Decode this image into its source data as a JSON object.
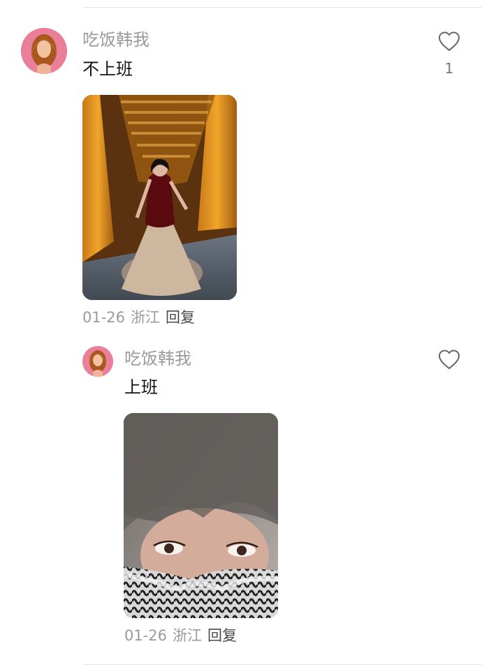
{
  "comment": {
    "username": "吃饭韩我",
    "text": "不上班",
    "like_count": "1",
    "date": "01-26",
    "location": "浙江",
    "reply_label": "回复",
    "like_icon": "heart-outline-icon"
  },
  "reply": {
    "username": "吃饭韩我",
    "text": "上班",
    "date": "01-26",
    "location": "浙江",
    "reply_label": "回复",
    "like_icon": "heart-outline-icon"
  },
  "colors": {
    "username": "#9a9a9a",
    "text": "#111111",
    "meta": "#9a9a9a",
    "reply_action": "#4a4a4a",
    "divider": "#e6e6e6"
  }
}
